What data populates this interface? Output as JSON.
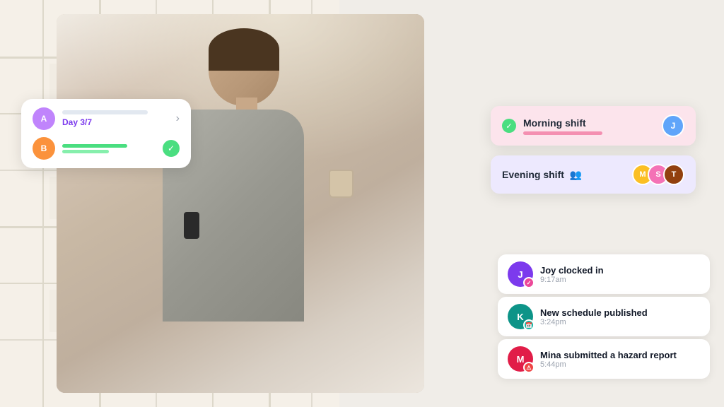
{
  "map": {
    "alt": "Map background"
  },
  "task_card": {
    "avatar_initials": "A",
    "day_label": "Day 3/7",
    "chevron": "›",
    "user_initials": "B"
  },
  "morning_shift": {
    "title": "Morning shift",
    "avatar_initials": "J"
  },
  "evening_shift": {
    "title": "Evening shift",
    "avatars": [
      {
        "initials": "M",
        "color": "#fbbf24"
      },
      {
        "initials": "S",
        "color": "#f472b6"
      },
      {
        "initials": "T",
        "color": "#92400e"
      }
    ]
  },
  "activity": {
    "items": [
      {
        "avatar_initials": "J",
        "avatar_color": "#7c3aed",
        "badge_color": "badge-pink",
        "badge_symbol": "✓",
        "title": "Joy clocked in",
        "time": "9:17am"
      },
      {
        "avatar_initials": "K",
        "avatar_color": "#0d9488",
        "badge_color": "badge-teal",
        "badge_symbol": "📅",
        "title": "New schedule published",
        "time": "3:24pm"
      },
      {
        "avatar_initials": "M",
        "avatar_color": "#e11d48",
        "badge_color": "badge-red",
        "badge_symbol": "⚠",
        "title": "Mina submitted a hazard report",
        "time": "5:44pm"
      }
    ]
  }
}
